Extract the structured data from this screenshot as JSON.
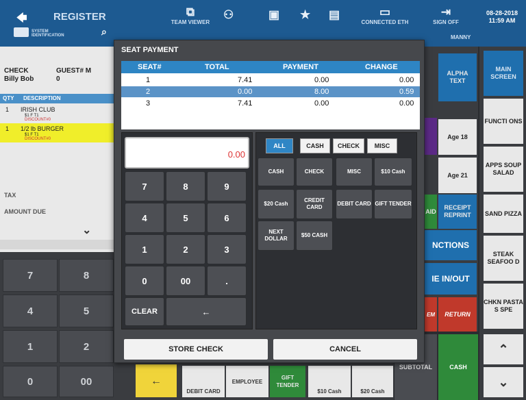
{
  "topbar": {
    "register_label": "REGISTER",
    "system_label": "SYSTEM IDENTIFICATION",
    "team_viewer": "TEAM VIEWER",
    "connected": "CONNECTED ETH",
    "sign_off": "SIGN OFF",
    "user": "MANNY",
    "date": "08-28-2018",
    "time": "11:59 AM"
  },
  "check": {
    "check_label": "CHECK",
    "check_name": "Billy Bob",
    "guest_label": "GUEST# M",
    "guest_value": "0",
    "qty_header": "QTY",
    "desc_header": "DESCRIPTION",
    "items": [
      {
        "qty": "1",
        "desc": "IRISH CLUB",
        "sub": "$1 F T1",
        "disc": "DISCOUNT#0"
      },
      {
        "qty": "1",
        "desc": "1/2 lb BURGER",
        "sub": "$1 F T1",
        "disc": "DISCOUNT#0"
      }
    ],
    "tax_label": "TAX",
    "amount_due_label": "AMOUNT DUE"
  },
  "left_keys": [
    "7",
    "8",
    "4",
    "5",
    "1",
    "2",
    "0",
    "00"
  ],
  "right_buttons": {
    "alpha_text": "ALPHA TEXT",
    "main_screen": "MAIN SCREEN",
    "functions": "FUNCTI ONS",
    "age18": "Age 18",
    "apps": "APPS SOUP SALAD",
    "age21": "Age 21",
    "receipt_reprint": "RECEIPT REPRINT",
    "sand_pizza": "SAND PIZZA",
    "nctions": "NCTIONS",
    "steak": "STEAK SEAFOO D",
    "ie_in_out": "IE IN/OUT",
    "chkn": "CHKN PASTA S SPE",
    "em": "EM",
    "return": "RETURN",
    "subtotal": "SUBTOTAL",
    "cash": "CASH",
    "aid": "AID"
  },
  "bottom": {
    "debit_card": "DEBIT CARD",
    "employee": "EMPLOYEE",
    "gift_tender": "GIFT TENDER",
    "ten_cash": "$10 Cash",
    "twenty_cash": "$20 Cash"
  },
  "modal": {
    "title": "SEAT PAYMENT",
    "headers": {
      "seat": "SEAT#",
      "total": "TOTAL",
      "payment": "PAYMENT",
      "change": "CHANGE"
    },
    "rows": [
      {
        "seat": "1",
        "total": "7.41",
        "payment": "0.00",
        "change": "0.00"
      },
      {
        "seat": "2",
        "total": "0.00",
        "payment": "8.00",
        "change": "0.59"
      },
      {
        "seat": "3",
        "total": "7.41",
        "payment": "0.00",
        "change": "0.00"
      }
    ],
    "display_value": "0.00",
    "numpad": [
      "7",
      "8",
      "9",
      "4",
      "5",
      "6",
      "1",
      "2",
      "3",
      "0",
      "00",
      "."
    ],
    "clear": "CLEAR",
    "backspace": "←",
    "filters": [
      "ALL",
      "CASH",
      "CHECK",
      "MISC"
    ],
    "tenders": [
      "CASH",
      "CHECK",
      "MISC",
      "$10 Cash",
      "$20 Cash",
      "CREDIT CARD",
      "DEBIT CARD",
      "GIFT TENDER",
      "NEXT DOLLAR",
      "$50 CASH"
    ],
    "store_check": "STORE CHECK",
    "cancel": "CANCEL"
  },
  "colors": {
    "accent": "#2f86c5",
    "topbar": "#1d5a91",
    "selected_row": "#5b93c7"
  }
}
